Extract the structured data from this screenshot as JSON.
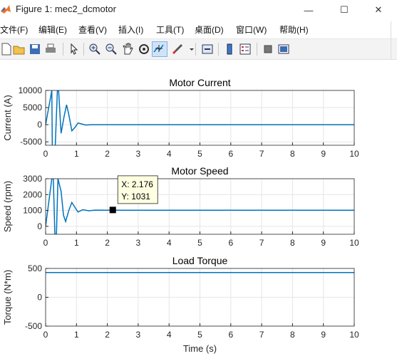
{
  "window": {
    "title": "Figure 1: mec2_dcmotor",
    "minimize_glyph": "—",
    "maximize_glyph": "☐",
    "close_glyph": "✕"
  },
  "menu": [
    "文件(F)",
    "编辑(E)",
    "查看(V)",
    "插入(I)",
    "工具(T)",
    "桌面(D)",
    "窗口(W)",
    "帮助(H)"
  ],
  "toolbar_icons": [
    "new-figure-icon",
    "open-file-icon",
    "save-icon",
    "print-icon",
    "pointer-icon",
    "zoom-in-icon",
    "zoom-out-icon",
    "pan-icon",
    "rotate-3d-icon",
    "data-cursor-icon",
    "brush-icon",
    "link-plot-icon",
    "colorbar-icon",
    "legend-icon",
    "hide-plot-tools-icon",
    "show-plot-tools-icon"
  ],
  "colors": {
    "line": "#0072bd",
    "axis": "#262626",
    "grid": "#e5e5e5"
  },
  "plots": [
    {
      "title": "Motor Current",
      "ylabel": "Current (A)",
      "xlabel": "",
      "ylim": [
        -6000,
        10000
      ],
      "yticks": [
        -5000,
        0,
        5000,
        10000
      ],
      "ytick_labels": [
        "-5000",
        "0",
        "5000",
        "10000"
      ]
    },
    {
      "title": "Motor Speed",
      "ylabel": "Speed (rpm)",
      "xlabel": "",
      "ylim": [
        -500,
        3000
      ],
      "yticks": [
        0,
        1000,
        2000,
        3000
      ],
      "ytick_labels": [
        "0",
        "1000",
        "2000",
        "3000"
      ]
    },
    {
      "title": "Load Torque",
      "ylabel": "Torque (N*m)",
      "xlabel": "Time (s)",
      "ylim": [
        -500,
        500
      ],
      "yticks": [
        -500,
        0,
        500
      ],
      "ytick_labels": [
        "-500",
        "0",
        "500"
      ]
    }
  ],
  "xticks": [
    0,
    1,
    2,
    3,
    4,
    5,
    6,
    7,
    8,
    9,
    10
  ],
  "xtick_labels": [
    "0",
    "1",
    "2",
    "3",
    "4",
    "5",
    "6",
    "7",
    "8",
    "9",
    "10"
  ],
  "datatip": {
    "x_text": "X: 2.176",
    "y_text": "Y: 1031",
    "x": 2.176,
    "y": 1031
  },
  "chart_data": [
    {
      "type": "line",
      "title": "Motor Current",
      "ylabel": "Current (A)",
      "xlim": [
        0,
        10
      ],
      "ylim": [
        -6000,
        10000
      ],
      "grid": true,
      "series": [
        {
          "x": [
            0,
            0.2,
            0.22,
            0.3,
            0.38,
            0.42,
            0.5,
            0.6,
            0.68,
            0.75,
            0.85,
            0.95,
            1.05,
            1.15,
            1.3,
            1.5,
            2,
            4,
            6,
            8,
            10
          ],
          "values": [
            0,
            10000,
            -9000,
            -9000,
            10000,
            10000,
            -2500,
            2500,
            5800,
            3000,
            -1800,
            -800,
            500,
            250,
            -100,
            0,
            0,
            0,
            0,
            0,
            0
          ]
        }
      ]
    },
    {
      "type": "line",
      "title": "Motor Speed",
      "ylabel": "Speed (rpm)",
      "xlim": [
        0,
        10
      ],
      "ylim": [
        -500,
        3000
      ],
      "grid": true,
      "series": [
        {
          "x": [
            0,
            0.2,
            0.25,
            0.3,
            0.35,
            0.4,
            0.5,
            0.58,
            0.65,
            0.75,
            0.85,
            0.95,
            1.05,
            1.2,
            1.4,
            1.6,
            2,
            4,
            6,
            8,
            10
          ],
          "values": [
            0,
            3000,
            3000,
            -500,
            -500,
            3000,
            2200,
            700,
            300,
            1000,
            1500,
            1200,
            900,
            1050,
            980,
            1020,
            1010,
            1010,
            1010,
            1010,
            1010
          ]
        }
      ]
    },
    {
      "type": "line",
      "title": "Load Torque",
      "ylabel": "Torque (N*m)",
      "xlabel": "Time (s)",
      "xlim": [
        0,
        10
      ],
      "ylim": [
        -500,
        500
      ],
      "grid": true,
      "series": [
        {
          "x": [
            0,
            10
          ],
          "values": [
            430,
            430
          ]
        }
      ]
    }
  ]
}
